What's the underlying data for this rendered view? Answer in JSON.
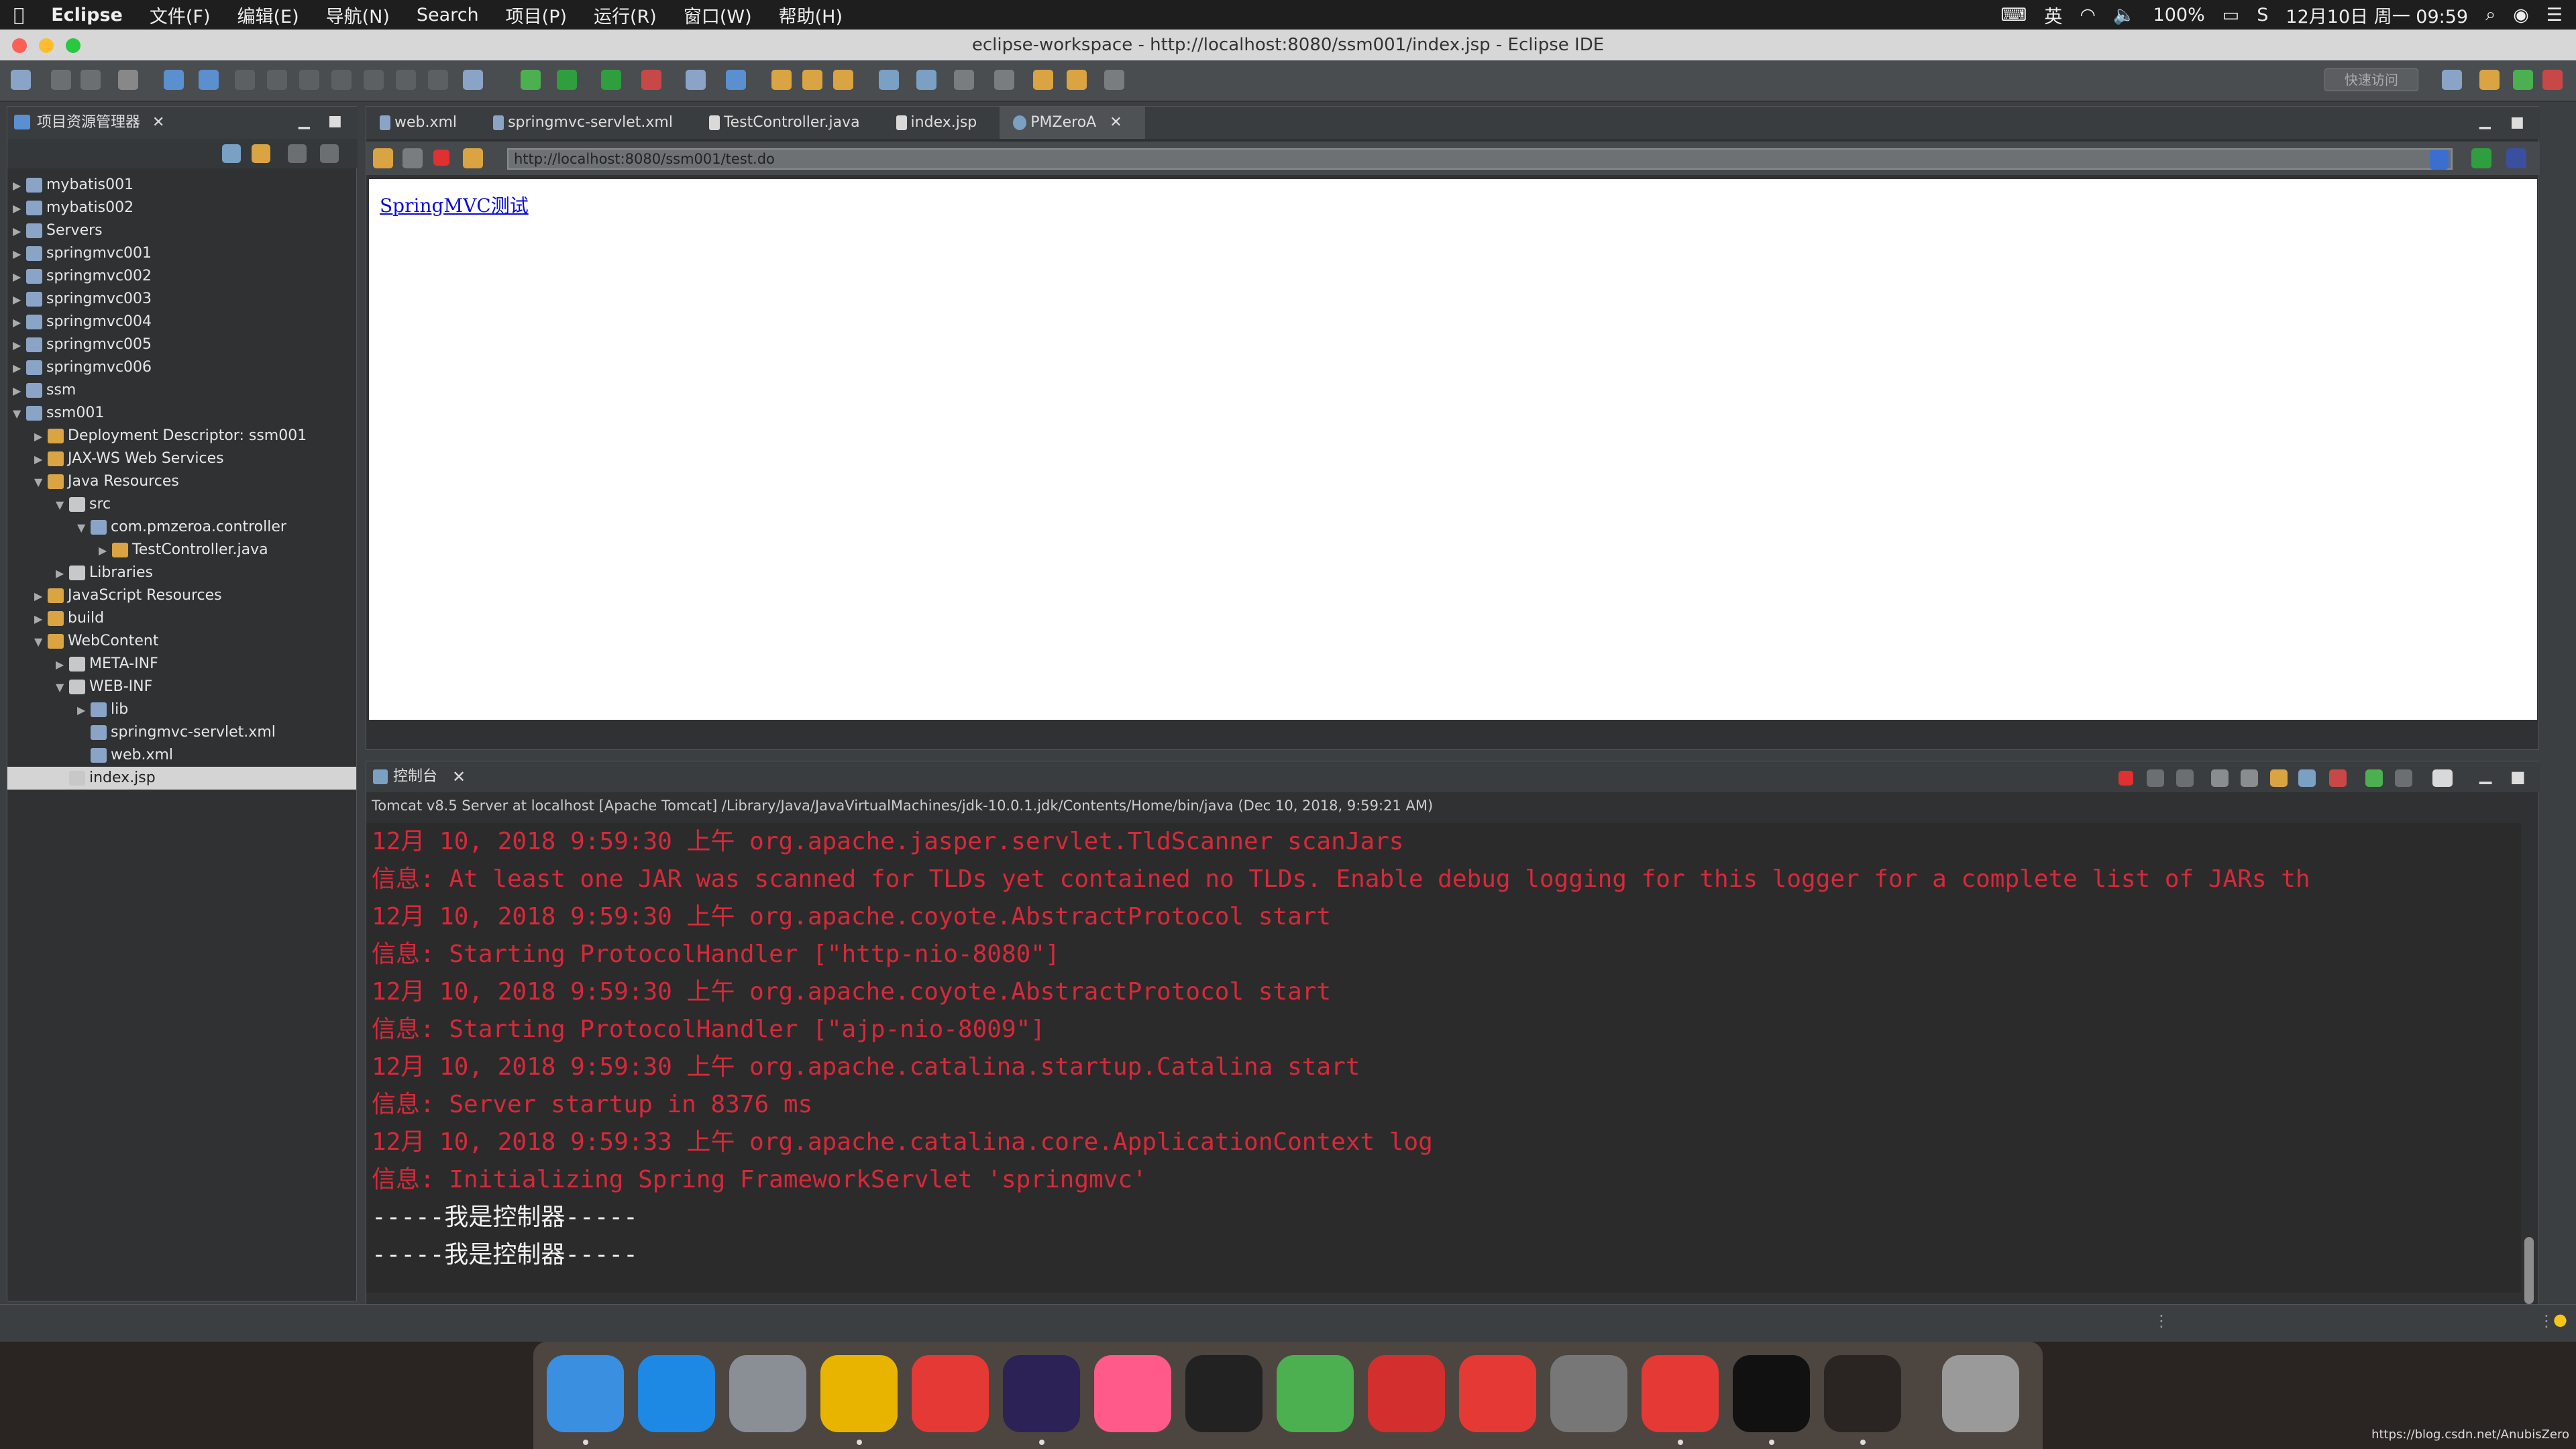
{
  "menubar": {
    "apple": "",
    "items": [
      "Eclipse",
      "文件(F)",
      "编辑(E)",
      "导航(N)",
      "Search",
      "项目(P)",
      "运行(R)",
      "窗口(W)",
      "帮助(H)"
    ],
    "input_lang": "英",
    "battery": "100%",
    "datetime": "12月10日 周一  09:59"
  },
  "window": {
    "title": "eclipse-workspace - http://localhost:8080/ssm001/index.jsp - Eclipse IDE",
    "quick_access": "快速访问"
  },
  "explorer": {
    "title": "项目资源管理器",
    "tree": [
      {
        "label": "mybatis001",
        "indent": 0,
        "arrow": "▶"
      },
      {
        "label": "mybatis002",
        "indent": 0,
        "arrow": "▶"
      },
      {
        "label": "Servers",
        "indent": 0,
        "arrow": "▶"
      },
      {
        "label": "springmvc001",
        "indent": 0,
        "arrow": "▶"
      },
      {
        "label": "springmvc002",
        "indent": 0,
        "arrow": "▶"
      },
      {
        "label": "springmvc003",
        "indent": 0,
        "arrow": "▶"
      },
      {
        "label": "springmvc004",
        "indent": 0,
        "arrow": "▶"
      },
      {
        "label": "springmvc005",
        "indent": 0,
        "arrow": "▶"
      },
      {
        "label": "springmvc006",
        "indent": 0,
        "arrow": "▶"
      },
      {
        "label": "ssm",
        "indent": 0,
        "arrow": "▶"
      },
      {
        "label": "ssm001",
        "indent": 0,
        "arrow": "▼"
      },
      {
        "label": "Deployment Descriptor: ssm001",
        "indent": 1,
        "arrow": "▶"
      },
      {
        "label": "JAX-WS Web Services",
        "indent": 1,
        "arrow": "▶"
      },
      {
        "label": "Java Resources",
        "indent": 1,
        "arrow": "▼"
      },
      {
        "label": "src",
        "indent": 2,
        "arrow": "▼"
      },
      {
        "label": "com.pmzeroa.controller",
        "indent": 3,
        "arrow": "▼"
      },
      {
        "label": "TestController.java",
        "indent": 4,
        "arrow": "▶"
      },
      {
        "label": "Libraries",
        "indent": 2,
        "arrow": "▶"
      },
      {
        "label": "JavaScript Resources",
        "indent": 1,
        "arrow": "▶"
      },
      {
        "label": "build",
        "indent": 1,
        "arrow": "▶"
      },
      {
        "label": "WebContent",
        "indent": 1,
        "arrow": "▼"
      },
      {
        "label": "META-INF",
        "indent": 2,
        "arrow": "▶"
      },
      {
        "label": "WEB-INF",
        "indent": 2,
        "arrow": "▼"
      },
      {
        "label": "lib",
        "indent": 3,
        "arrow": "▶"
      },
      {
        "label": "springmvc-servlet.xml",
        "indent": 3,
        "arrow": ""
      },
      {
        "label": "web.xml",
        "indent": 3,
        "arrow": ""
      },
      {
        "label": "index.jsp",
        "indent": 2,
        "arrow": "",
        "selected": true
      }
    ]
  },
  "editor": {
    "tabs": [
      "web.xml",
      "springmvc-servlet.xml",
      "TestController.java",
      "index.jsp",
      "PMZeroA"
    ],
    "url": "http://localhost:8080/ssm001/test.do",
    "link_text": "SpringMVC测试"
  },
  "console": {
    "title": "控制台",
    "info": "Tomcat v8.5 Server at localhost [Apache Tomcat] /Library/Java/JavaVirtualMachines/jdk-10.0.1.jdk/Contents/Home/bin/java  (Dec 10, 2018, 9:59:21 AM)",
    "lines": [
      {
        "text": "12月 10, 2018 9:59:30 上午 org.apache.jasper.servlet.TldScanner scanJars",
        "color": "red"
      },
      {
        "text": "信息: At least one JAR was scanned for TLDs yet contained no TLDs. Enable debug logging for this logger for a complete list of JARs th",
        "color": "red"
      },
      {
        "text": "12月 10, 2018 9:59:30 上午 org.apache.coyote.AbstractProtocol start",
        "color": "red"
      },
      {
        "text": "信息: Starting ProtocolHandler [\"http-nio-8080\"]",
        "color": "red"
      },
      {
        "text": "12月 10, 2018 9:59:30 上午 org.apache.coyote.AbstractProtocol start",
        "color": "red"
      },
      {
        "text": "信息: Starting ProtocolHandler [\"ajp-nio-8009\"]",
        "color": "red"
      },
      {
        "text": "12月 10, 2018 9:59:30 上午 org.apache.catalina.startup.Catalina start",
        "color": "red"
      },
      {
        "text": "信息: Server startup in 8376 ms",
        "color": "red"
      },
      {
        "text": "12月 10, 2018 9:59:33 上午 org.apache.catalina.core.ApplicationContext log",
        "color": "red"
      },
      {
        "text": "信息: Initializing Spring FrameworkServlet 'springmvc'",
        "color": "red"
      },
      {
        "text": "-----我是控制器-----",
        "color": "white"
      },
      {
        "text": "-----我是控制器-----",
        "color": "white"
      }
    ]
  },
  "dock": {
    "apps": [
      {
        "icon": "finder-icon",
        "color": "#3b8fe0",
        "running": true
      },
      {
        "icon": "app-store-icon",
        "color": "#1e88e5",
        "running": false
      },
      {
        "icon": "launchpad-icon",
        "color": "#8a8f96",
        "running": false
      },
      {
        "icon": "chrome-icon",
        "color": "#e8b400",
        "running": true
      },
      {
        "icon": "xmind-icon",
        "color": "#e53935",
        "running": false
      },
      {
        "icon": "eclipse-icon",
        "color": "#2c2255",
        "running": true
      },
      {
        "icon": "itunes-icon",
        "color": "#ff5a8a",
        "running": false
      },
      {
        "icon": "qq-icon",
        "color": "#222",
        "running": false
      },
      {
        "icon": "wechat-icon",
        "color": "#4caf50",
        "running": false
      },
      {
        "icon": "netease-music-icon",
        "color": "#d32f2f",
        "running": false
      },
      {
        "icon": "bookmark-icon",
        "color": "#e53935",
        "running": false
      },
      {
        "icon": "system-preferences-icon",
        "color": "#777",
        "running": false
      },
      {
        "icon": "screen-recorder-icon",
        "color": "#e53935",
        "running": true
      },
      {
        "icon": "terminal-icon",
        "color": "#111",
        "running": true
      },
      {
        "icon": "navicat-icon",
        "color": "#2a2522",
        "running": true
      },
      {
        "icon": "trash-icon",
        "color": "#9a9a9a",
        "running": false
      }
    ]
  },
  "watermark": "https://blog.csdn.net/AnubisZero"
}
